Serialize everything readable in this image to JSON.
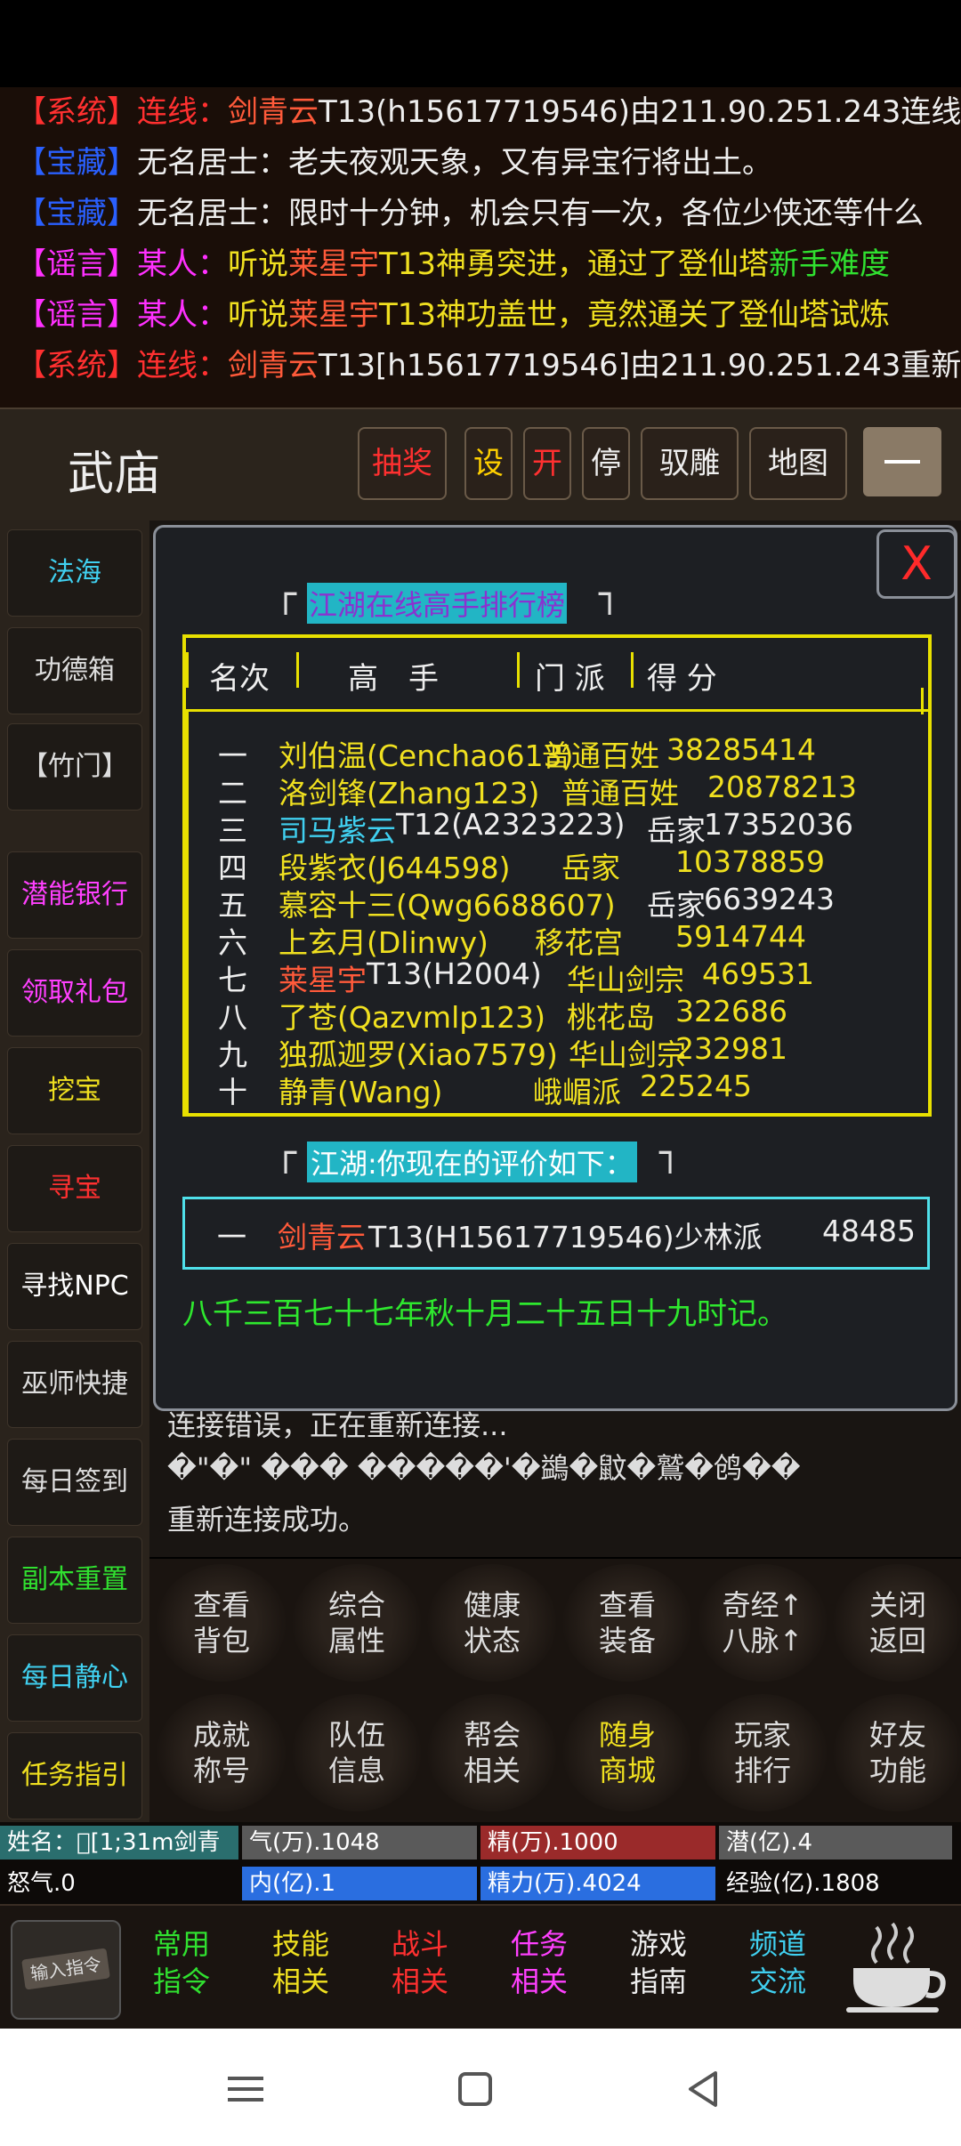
{
  "chat": [
    [
      {
        "t": "【系统】",
        "c": "#ff3030"
      },
      {
        "t": "连线：",
        "c": "#ff3030"
      },
      {
        "t": "剑青云",
        "c": "#ff5a3a"
      },
      {
        "t": "T13(h15617719546)由211.90.251.243连线",
        "c": "#eeeeee"
      }
    ],
    [
      {
        "t": "【宝藏】",
        "c": "#2a60ff"
      },
      {
        "t": "无名居士：老夫夜观天象，又有异宝行将出土。",
        "c": "#eeeeee"
      }
    ],
    [
      {
        "t": "【宝藏】",
        "c": "#2a60ff"
      },
      {
        "t": "无名居士：限时十分钟，机会只有一次，各位少侠还等什么",
        "c": "#eeeeee"
      }
    ],
    [
      {
        "t": "【谣言】",
        "c": "#ff30ff"
      },
      {
        "t": "某人：",
        "c": "#ff30ff"
      },
      {
        "t": "听说",
        "c": "#f0e020"
      },
      {
        "t": "莱星宇",
        "c": "#ff5a3a"
      },
      {
        "t": "T13神勇突进，通过了登仙塔",
        "c": "#f0e020"
      },
      {
        "t": "新手难度",
        "c": "#30e030"
      }
    ],
    [
      {
        "t": "【谣言】",
        "c": "#ff30ff"
      },
      {
        "t": "某人：",
        "c": "#ff30ff"
      },
      {
        "t": "听说",
        "c": "#f0e020"
      },
      {
        "t": "莱星宇",
        "c": "#ff5a3a"
      },
      {
        "t": "T13神功盖世，竟然通关了登仙塔试炼",
        "c": "#f0e020"
      }
    ],
    [
      {
        "t": "【系统】",
        "c": "#ff3030"
      },
      {
        "t": "连线：",
        "c": "#ff3030"
      },
      {
        "t": "剑青云",
        "c": "#ff5a3a"
      },
      {
        "t": "T13[h15617719546]由211.90.251.243重新",
        "c": "#eeeeee"
      }
    ]
  ],
  "header": {
    "title": "武庙",
    "buttons": [
      {
        "label": "抽奖",
        "color": "#ff3030"
      },
      {
        "label": "设",
        "color": "#ffd000"
      },
      {
        "label": "开",
        "color": "#ff3030"
      },
      {
        "label": "停",
        "color": "#eeeeee"
      },
      {
        "label": "驭雕",
        "color": "#eeeeee"
      },
      {
        "label": "地图",
        "color": "#eeeeee"
      }
    ]
  },
  "sidebar": [
    {
      "label": "法海",
      "color": "#40d0f0"
    },
    {
      "label": "功德箱",
      "color": "#dddddd"
    },
    {
      "label": "【竹门】",
      "color": "#dddddd"
    },
    {
      "label": "潜能银行",
      "color": "#ff40ff"
    },
    {
      "label": "领取礼包",
      "color": "#ff40ff"
    },
    {
      "label": "挖宝",
      "color": "#f0e020"
    },
    {
      "label": "寻宝",
      "color": "#ff3030"
    },
    {
      "label": "寻找NPC",
      "color": "#ffffff"
    },
    {
      "label": "巫师快捷",
      "color": "#dddddd"
    },
    {
      "label": "每日签到",
      "color": "#dddddd"
    },
    {
      "label": "副本重置",
      "color": "#30e030"
    },
    {
      "label": "每日静心",
      "color": "#40d0f0"
    },
    {
      "label": "任务指引",
      "color": "#f0e020"
    }
  ],
  "log": [
    "连接错误，正在重新连接...",
    "�\"�\"  ���  �����'�鷁�鼤�鷲�鸧��",
    "重新连接成功。"
  ],
  "dialog": {
    "close_label": "X",
    "rank_title": "江湖在线高手排行榜",
    "headers": [
      "名次",
      "高　手",
      "门 派",
      "得 分"
    ],
    "rows": [
      {
        "rank": "一",
        "name": "刘伯温(Cenchao613)",
        "name_color": "#f0e020",
        "school": "普通百姓",
        "score": "38285414"
      },
      {
        "rank": "二",
        "name": "洛剑锋(Zhang123)",
        "name_color": "#f0e020",
        "school": "普通百姓",
        "score": "20878213"
      },
      {
        "rank": "三",
        "name": "司马紫云",
        "name_color": "#40d0f0",
        "suffix": "T12(A2323223)",
        "school": "岳家",
        "score": "17352036"
      },
      {
        "rank": "四",
        "name": "段紫衣(J644598)",
        "name_color": "#f0e020",
        "school": "岳家",
        "score": "10378859"
      },
      {
        "rank": "五",
        "name": "慕容十三(Qwg6688607)",
        "name_color": "#f0e020",
        "school": "岳家",
        "score": "6639243"
      },
      {
        "rank": "六",
        "name": "上玄月(Dlinwy)",
        "name_color": "#f0e020",
        "school": "移花宫",
        "score": "5914744"
      },
      {
        "rank": "七",
        "name": "莱星宇",
        "name_color": "#ff5a3a",
        "suffix": "T13(H2004)",
        "school": "华山剑宗",
        "score": "469531"
      },
      {
        "rank": "八",
        "name": "了苍(Qazvmlp123)",
        "name_color": "#f0e020",
        "school": "桃花岛",
        "score": "322686"
      },
      {
        "rank": "九",
        "name": "独孤迦罗(Xiao7579)",
        "name_color": "#f0e020",
        "school": "华山剑宗",
        "score": "232981"
      },
      {
        "rank": "十",
        "name": "静青(Wang)",
        "name_color": "#f0e020",
        "school": "峨嵋派",
        "score": "225245"
      }
    ],
    "eval_title": "江湖:你现在的评价如下：",
    "eval": {
      "rank": "一",
      "name": "剑青云",
      "suffix": "T13(H15617719546)少林派",
      "score": "48485"
    },
    "timestamp": "八千三百七十七年秋十月二十五日十九时记。"
  },
  "commands": [
    {
      "label": "查看\n背包",
      "color": "#dddddd"
    },
    {
      "label": "综合\n属性",
      "color": "#dddddd"
    },
    {
      "label": "健康\n状态",
      "color": "#dddddd"
    },
    {
      "label": "查看\n装备",
      "color": "#dddddd"
    },
    {
      "label": "奇经↑\n八脉↑",
      "color": "#dddddd"
    },
    {
      "label": "关闭\n返回",
      "color": "#dddddd"
    },
    {
      "label": "成就\n称号",
      "color": "#dddddd"
    },
    {
      "label": "队伍\n信息",
      "color": "#dddddd"
    },
    {
      "label": "帮会\n相关",
      "color": "#dddddd"
    },
    {
      "label": "随身\n商城",
      "color": "#f0e020"
    },
    {
      "label": "玩家\n排行",
      "color": "#dddddd"
    },
    {
      "label": "好友\n功能",
      "color": "#dddddd"
    }
  ],
  "stats": {
    "name": "姓名：\u0000[1;31m剑青",
    "qi": "气(万).1048",
    "jing": "精(万).1000",
    "qian": "潜(亿).4",
    "nuqi": "怒气.0",
    "nei": "内(亿).1",
    "jingli": "精力(万).4024",
    "jingyan": "经验(亿).1808",
    "colors": {
      "name": "#2a6e6e",
      "qi": "#5a5a5a",
      "jing": "#9a2a2a",
      "qian": "#5a5a5a",
      "nuqi": "#0d0a08",
      "nei": "#2a6ee0",
      "jingli": "#2a6ee0",
      "jingyan": "#0d0a08"
    }
  },
  "menu": {
    "input_label": "输入指令",
    "items": [
      {
        "label": "常用\n指令",
        "color": "#30e030"
      },
      {
        "label": "技能\n相关",
        "color": "#f0e020"
      },
      {
        "label": "战斗\n相关",
        "color": "#ff3030"
      },
      {
        "label": "任务\n相关",
        "color": "#ff40ff"
      },
      {
        "label": "游戏\n指南",
        "color": "#eeeeee"
      },
      {
        "label": "频道\n交流",
        "color": "#40d0f0"
      }
    ]
  }
}
